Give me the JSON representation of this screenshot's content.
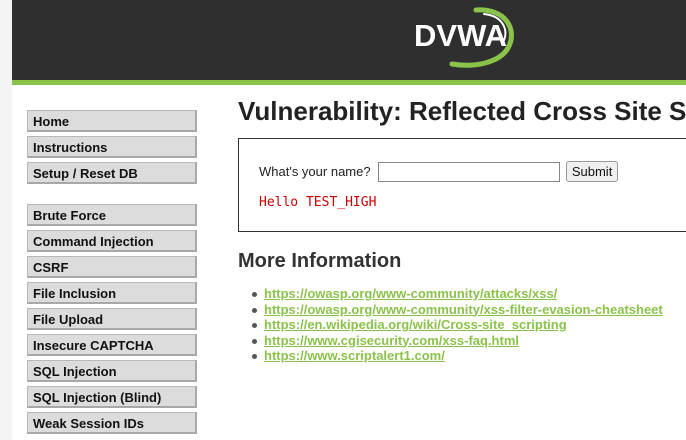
{
  "header": {
    "logo_text": "DVWA",
    "accent_color": "#8bc34a",
    "background_color": "#2f2f2f"
  },
  "menu": {
    "groups": [
      [
        "Home",
        "Instructions",
        "Setup / Reset DB"
      ],
      [
        "Brute Force",
        "Command Injection",
        "CSRF",
        "File Inclusion",
        "File Upload",
        "Insecure CAPTCHA",
        "SQL Injection",
        "SQL Injection (Blind)",
        "Weak Session IDs"
      ]
    ]
  },
  "main": {
    "title": "Vulnerability: Reflected Cross Site Scripting (XSS)",
    "form": {
      "label": "What's your name?",
      "input_value": "",
      "submit_label": "Submit"
    },
    "output": "Hello TEST_HIGH",
    "more_info_heading": "More Information",
    "links": [
      "https://owasp.org/www-community/attacks/xss/",
      "https://owasp.org/www-community/xss-filter-evasion-cheatsheet",
      "https://en.wikipedia.org/wiki/Cross-site_scripting",
      "https://www.cgisecurity.com/xss-faq.html",
      "https://www.scriptalert1.com/"
    ]
  }
}
